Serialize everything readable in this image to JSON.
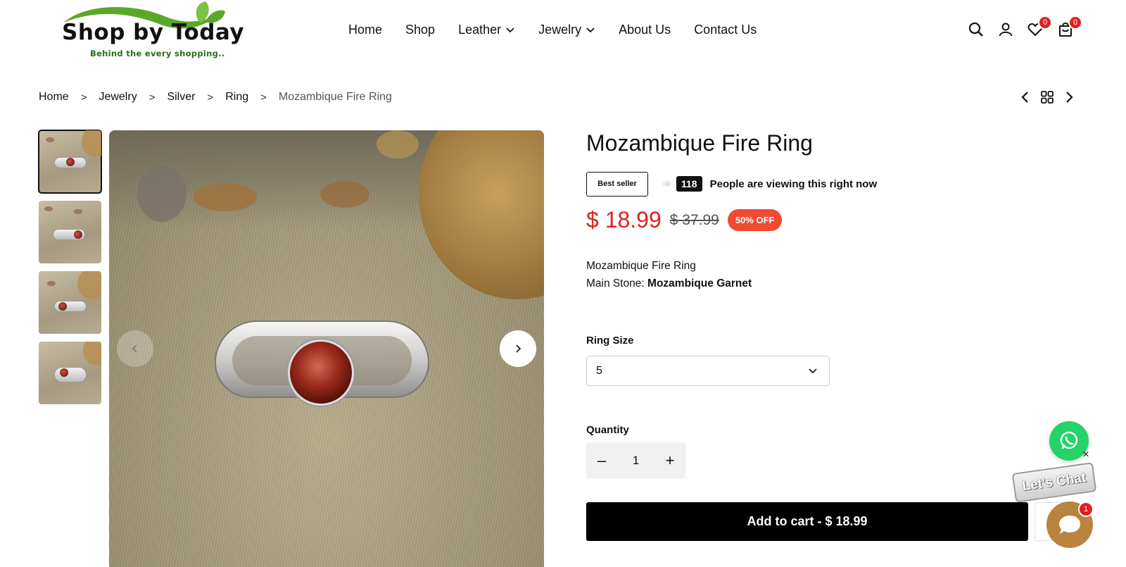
{
  "brand": {
    "name": "Shop by Today",
    "tagline": "Behind the every shopping.."
  },
  "nav": {
    "items": [
      {
        "label": "Home",
        "has_dropdown": false
      },
      {
        "label": "Shop",
        "has_dropdown": false
      },
      {
        "label": "Leather",
        "has_dropdown": true
      },
      {
        "label": "Jewelry",
        "has_dropdown": true
      },
      {
        "label": "About Us",
        "has_dropdown": false
      },
      {
        "label": "Contact Us",
        "has_dropdown": false
      }
    ]
  },
  "header_icons": {
    "search": "search-icon",
    "account": "user-icon",
    "wishlist": "heart-icon",
    "wishlist_count": "0",
    "cart": "bag-icon",
    "cart_count": "0"
  },
  "breadcrumb": {
    "items": [
      "Home",
      "Jewelry",
      "Silver",
      "Ring",
      "Mozambique Fire Ring"
    ],
    "separator": ">"
  },
  "product": {
    "title": "Mozambique Fire Ring",
    "badge": "Best seller",
    "viewers": "118",
    "viewers_text": "People are viewing this right now",
    "price": "$ 18.99",
    "compare_price": "$ 37.99",
    "discount": "50% OFF",
    "description_line1": "Mozambique Fire Ring",
    "main_stone_label": "Main Stone:",
    "main_stone_value": "Mozambique Garnet",
    "ring_size_label": "Ring Size",
    "ring_size_value": "5",
    "quantity_label": "Quantity",
    "quantity": "1",
    "qty_minus": "–",
    "qty_plus": "+",
    "add_to_cart": "Add to cart - $ 18.99"
  },
  "chat": {
    "lets_chat": "Let's Chat",
    "close": "×",
    "unread": "1"
  },
  "colors": {
    "price": "#e0201c",
    "discount_badge": "#f04a32",
    "whatsapp": "#25d366",
    "chat_bubble": "#b8843e",
    "logo_green": "#5ba829"
  }
}
